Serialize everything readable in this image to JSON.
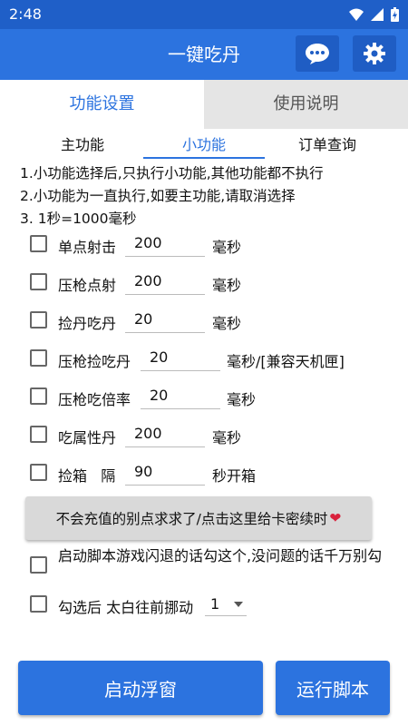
{
  "status_bar": {
    "time": "2:48"
  },
  "app_bar": {
    "title": "一键吃丹"
  },
  "top_tabs": [
    {
      "label": "功能设置",
      "active": true
    },
    {
      "label": "使用说明",
      "active": false
    }
  ],
  "sub_tabs": [
    {
      "label": "主功能",
      "active": false
    },
    {
      "label": "小功能",
      "active": true
    },
    {
      "label": "订单查询",
      "active": false
    }
  ],
  "notes": [
    "1.小功能选择后,只执行小功能,其他功能都不执行",
    "2.小功能为一直执行,如要主功能,请取消选择",
    "3. 1秒=1000毫秒"
  ],
  "options": [
    {
      "label": "单点射击",
      "value": "200",
      "unit": "毫秒",
      "checked": false
    },
    {
      "label": "压枪点射",
      "value": "200",
      "unit": "毫秒",
      "checked": false
    },
    {
      "label": "捡丹吃丹",
      "value": "20",
      "unit": "毫秒",
      "checked": false
    },
    {
      "label": "压枪捡吃丹",
      "value": "20",
      "unit": "毫秒/[兼容天机匣]",
      "checked": false
    },
    {
      "label": "压枪吃倍率",
      "value": "20",
      "unit": "毫秒",
      "checked": false
    },
    {
      "label": "吃属性丹",
      "value": "200",
      "unit": "毫秒",
      "checked": false
    },
    {
      "label": "捡箱   隔",
      "value": "90",
      "unit": "秒开箱",
      "checked": false
    }
  ],
  "recharge_button": {
    "label": "不会充值的别点求求了/点击这里给卡密续时",
    "icon": "heart-icon"
  },
  "crash_option": {
    "label": "启动脚本游戏闪退的话勾这个,没问题的话千万别勾",
    "checked": false
  },
  "taibai_option": {
    "label": "勾选后 太白往前挪动",
    "checked": false,
    "select_value": "1"
  },
  "buttons": {
    "float_window": "启动浮窗",
    "run_script": "运行脚本"
  },
  "colors": {
    "primary": "#2c73df",
    "status_bar": "#1f5fc8",
    "heart": "#d9213c"
  }
}
